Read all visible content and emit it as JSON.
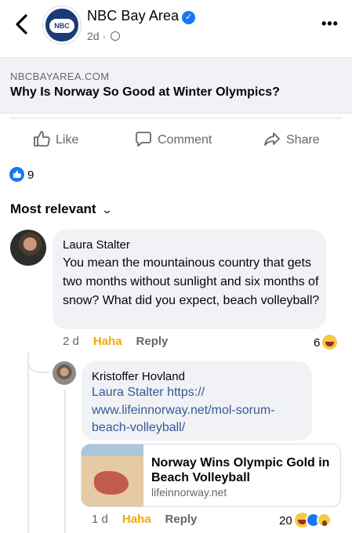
{
  "header": {
    "page_name": "NBC Bay Area",
    "post_time": "2d",
    "logo_text": "NBC"
  },
  "link_card": {
    "domain": "NBCBAYAREA.COM",
    "title": "Why Is Norway So Good at Winter Olympics?"
  },
  "actions": {
    "like": "Like",
    "comment": "Comment",
    "share": "Share"
  },
  "reactions": {
    "count": "9"
  },
  "sort": {
    "label": "Most relevant"
  },
  "comments": [
    {
      "author": "Laura Stalter",
      "text": "You mean the mountainous country that gets two months without sunlight and six months of snow?  What did you expect, beach volleyball?",
      "time": "2 d",
      "reaction_action": "Haha",
      "reply_label": "Reply",
      "reaction_count": "6"
    },
    {
      "author": "Kristoffer Hovland",
      "mention": "Laura Stalter",
      "link_text": "https:// www.lifeinnorway.net/mol-sorum-beach-volleyball/",
      "time": "1 d",
      "reaction_action": "Haha",
      "reply_label": "Reply",
      "reaction_count": "20",
      "preview": {
        "title": "Norway Wins Olympic Gold in Beach Volleyball",
        "domain": "lifeinnorway.net"
      }
    }
  ],
  "colors": {
    "brand_blue": "#1877f2",
    "link_blue": "#385898",
    "haha_yellow": "#f2a800",
    "bubble_gray": "#f0f2f5"
  },
  "icons": [
    "back-arrow-icon",
    "verified-icon",
    "globe-icon",
    "more-icon",
    "like-icon",
    "comment-icon",
    "share-icon",
    "haha-reaction-icon",
    "like-reaction-icon",
    "wow-reaction-icon"
  ]
}
